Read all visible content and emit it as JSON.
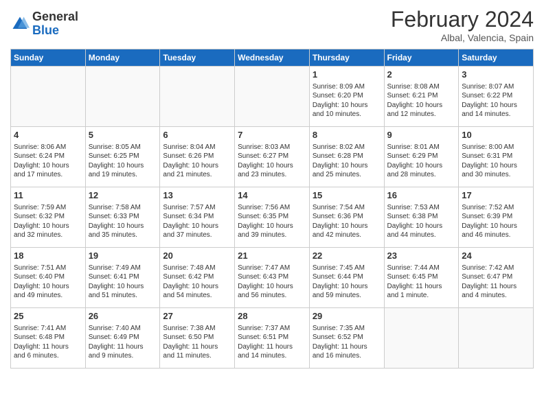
{
  "header": {
    "logo_general": "General",
    "logo_blue": "Blue",
    "title": "February 2024",
    "location": "Albal, Valencia, Spain"
  },
  "days_of_week": [
    "Sunday",
    "Monday",
    "Tuesday",
    "Wednesday",
    "Thursday",
    "Friday",
    "Saturday"
  ],
  "weeks": [
    [
      {
        "day": "",
        "info": ""
      },
      {
        "day": "",
        "info": ""
      },
      {
        "day": "",
        "info": ""
      },
      {
        "day": "",
        "info": ""
      },
      {
        "day": "1",
        "info": "Sunrise: 8:09 AM\nSunset: 6:20 PM\nDaylight: 10 hours\nand 10 minutes."
      },
      {
        "day": "2",
        "info": "Sunrise: 8:08 AM\nSunset: 6:21 PM\nDaylight: 10 hours\nand 12 minutes."
      },
      {
        "day": "3",
        "info": "Sunrise: 8:07 AM\nSunset: 6:22 PM\nDaylight: 10 hours\nand 14 minutes."
      }
    ],
    [
      {
        "day": "4",
        "info": "Sunrise: 8:06 AM\nSunset: 6:24 PM\nDaylight: 10 hours\nand 17 minutes."
      },
      {
        "day": "5",
        "info": "Sunrise: 8:05 AM\nSunset: 6:25 PM\nDaylight: 10 hours\nand 19 minutes."
      },
      {
        "day": "6",
        "info": "Sunrise: 8:04 AM\nSunset: 6:26 PM\nDaylight: 10 hours\nand 21 minutes."
      },
      {
        "day": "7",
        "info": "Sunrise: 8:03 AM\nSunset: 6:27 PM\nDaylight: 10 hours\nand 23 minutes."
      },
      {
        "day": "8",
        "info": "Sunrise: 8:02 AM\nSunset: 6:28 PM\nDaylight: 10 hours\nand 25 minutes."
      },
      {
        "day": "9",
        "info": "Sunrise: 8:01 AM\nSunset: 6:29 PM\nDaylight: 10 hours\nand 28 minutes."
      },
      {
        "day": "10",
        "info": "Sunrise: 8:00 AM\nSunset: 6:31 PM\nDaylight: 10 hours\nand 30 minutes."
      }
    ],
    [
      {
        "day": "11",
        "info": "Sunrise: 7:59 AM\nSunset: 6:32 PM\nDaylight: 10 hours\nand 32 minutes."
      },
      {
        "day": "12",
        "info": "Sunrise: 7:58 AM\nSunset: 6:33 PM\nDaylight: 10 hours\nand 35 minutes."
      },
      {
        "day": "13",
        "info": "Sunrise: 7:57 AM\nSunset: 6:34 PM\nDaylight: 10 hours\nand 37 minutes."
      },
      {
        "day": "14",
        "info": "Sunrise: 7:56 AM\nSunset: 6:35 PM\nDaylight: 10 hours\nand 39 minutes."
      },
      {
        "day": "15",
        "info": "Sunrise: 7:54 AM\nSunset: 6:36 PM\nDaylight: 10 hours\nand 42 minutes."
      },
      {
        "day": "16",
        "info": "Sunrise: 7:53 AM\nSunset: 6:38 PM\nDaylight: 10 hours\nand 44 minutes."
      },
      {
        "day": "17",
        "info": "Sunrise: 7:52 AM\nSunset: 6:39 PM\nDaylight: 10 hours\nand 46 minutes."
      }
    ],
    [
      {
        "day": "18",
        "info": "Sunrise: 7:51 AM\nSunset: 6:40 PM\nDaylight: 10 hours\nand 49 minutes."
      },
      {
        "day": "19",
        "info": "Sunrise: 7:49 AM\nSunset: 6:41 PM\nDaylight: 10 hours\nand 51 minutes."
      },
      {
        "day": "20",
        "info": "Sunrise: 7:48 AM\nSunset: 6:42 PM\nDaylight: 10 hours\nand 54 minutes."
      },
      {
        "day": "21",
        "info": "Sunrise: 7:47 AM\nSunset: 6:43 PM\nDaylight: 10 hours\nand 56 minutes."
      },
      {
        "day": "22",
        "info": "Sunrise: 7:45 AM\nSunset: 6:44 PM\nDaylight: 10 hours\nand 59 minutes."
      },
      {
        "day": "23",
        "info": "Sunrise: 7:44 AM\nSunset: 6:45 PM\nDaylight: 11 hours\nand 1 minute."
      },
      {
        "day": "24",
        "info": "Sunrise: 7:42 AM\nSunset: 6:47 PM\nDaylight: 11 hours\nand 4 minutes."
      }
    ],
    [
      {
        "day": "25",
        "info": "Sunrise: 7:41 AM\nSunset: 6:48 PM\nDaylight: 11 hours\nand 6 minutes."
      },
      {
        "day": "26",
        "info": "Sunrise: 7:40 AM\nSunset: 6:49 PM\nDaylight: 11 hours\nand 9 minutes."
      },
      {
        "day": "27",
        "info": "Sunrise: 7:38 AM\nSunset: 6:50 PM\nDaylight: 11 hours\nand 11 minutes."
      },
      {
        "day": "28",
        "info": "Sunrise: 7:37 AM\nSunset: 6:51 PM\nDaylight: 11 hours\nand 14 minutes."
      },
      {
        "day": "29",
        "info": "Sunrise: 7:35 AM\nSunset: 6:52 PM\nDaylight: 11 hours\nand 16 minutes."
      },
      {
        "day": "",
        "info": ""
      },
      {
        "day": "",
        "info": ""
      }
    ]
  ]
}
